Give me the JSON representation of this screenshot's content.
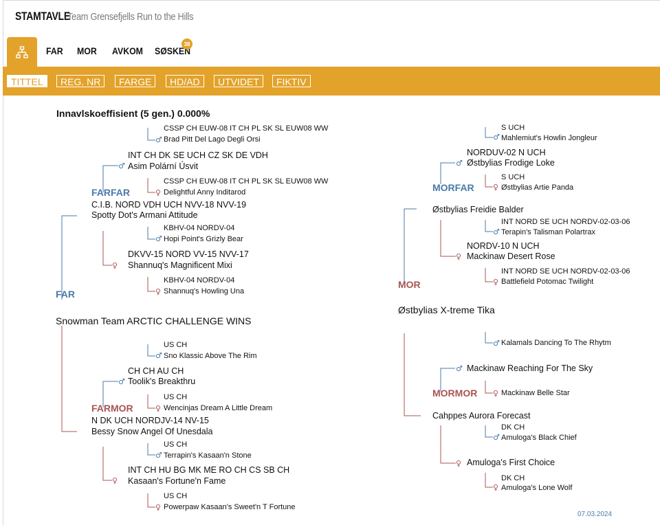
{
  "header": {
    "brand": "STAMTAVLE",
    "subtitle": "Team Grensefjells Run to the Hills"
  },
  "tabs": [
    {
      "label": "FAR"
    },
    {
      "label": "MOR"
    },
    {
      "label": "AVKOM"
    },
    {
      "label": "SØSKEN",
      "badge": "38"
    }
  ],
  "filters": [
    "TITTEL",
    "REG. NR",
    "FARGE",
    "HD/AD",
    "UTVIDET",
    "FIKTIV"
  ],
  "inbreeding": "Innavlskoeffisient (5 gen.) 0.000%",
  "roles": {
    "far": "FAR",
    "mor": "MOR",
    "farfar": "FARFAR",
    "farmor": "FARMOR",
    "morfar": "MORFAR",
    "mormor": "MORMOR"
  },
  "sire": {
    "name": "Snowman Team ARCTIC CHALLENGE WINS"
  },
  "dam": {
    "name": "Østbylias X-treme Tika"
  },
  "paternal": {
    "farfar": {
      "title": "C.I.B. NORD VDH UCH NVV-18 NVV-19",
      "name": "Spotty Dot's Armani Attitude"
    },
    "g3a": {
      "title": "INT CH DK SE UCH CZ SK DE VDH",
      "name": "Asim Polární Úsvit"
    },
    "g4a": {
      "title": "CSSP CH EUW-08 IT CH PL SK SL EUW08 WW",
      "name": "Brad Pitt Del Lago Degli Orsi"
    },
    "g4b": {
      "title": "CSSP CH EUW-08 IT CH PL SK SL EUW08 WW",
      "name": "Delightful Anny Inditarod"
    },
    "g3b": {
      "title": "DKVV-15 NORD VV-15 NVV-17",
      "name": "Shannuq's Magnificent Mixi"
    },
    "g4c": {
      "title": "KBHV-04 NORDV-04",
      "name": "Hopi Point's Grizly Bear"
    },
    "g4d": {
      "title": "KBHV-04 NORDV-04",
      "name": "Shannuq's Howling Una"
    },
    "farmor": {
      "title": "N DK UCH NORDJV-14 NV-15",
      "name": "Bessy Snow Angel Of Unesdala"
    },
    "g3c": {
      "title": "CH CH AU CH",
      "name": "Toolik's Breakthru"
    },
    "g4e": {
      "title": "US CH",
      "name": "Sno Klassic Above The Rim"
    },
    "g4f": {
      "title": "US CH",
      "name": "Wencinjas Dream A Little Dream"
    },
    "g3d": {
      "title": "INT CH HU BG MK ME RO CH CS SB CH",
      "name": "Kasaan's Fortune'n Fame"
    },
    "g4g": {
      "title": "US CH",
      "name": "Terrapin's Kasaan'n Stone"
    },
    "g4h": {
      "title": "US CH",
      "name": "Powerpaw Kasaan's Sweet'n T Fortune"
    }
  },
  "maternal": {
    "morfar": {
      "name": "Østbylias Freidie Balder"
    },
    "g3a": {
      "title": "NORDUV-02 N UCH",
      "name": "Østbylias Frodige Loke"
    },
    "g4a": {
      "title": "S UCH",
      "name": "Mahlemiut's Howlin Jongleur"
    },
    "g4b": {
      "title": "S UCH",
      "name": "Østbylias Artie Panda"
    },
    "g3b": {
      "title": "NORDV-10 N UCH",
      "name": "Mackinaw Desert Rose"
    },
    "g4c": {
      "title": "INT NORD SE UCH NORDV-02-03-06",
      "name": "Terapin's Talisman Polartrax"
    },
    "g4d": {
      "title": "INT NORD SE UCH NORDV-02-03-06",
      "name": "Battlefield Potomac Twilight"
    },
    "mormor": {
      "name": "Cahppes Aurora Forecast"
    },
    "g3c": {
      "name": "Mackinaw Reaching For The Sky"
    },
    "g4e": {
      "name": "Kalamals Dancing To The Rhytm"
    },
    "g4f": {
      "name": "Mackinaw Belle Star"
    },
    "g3d": {
      "name": "Amuloga's First Choice"
    },
    "g4g": {
      "title": "DK CH",
      "name": "Amuloga's Black Chief"
    },
    "g4h": {
      "title": "DK CH",
      "name": "Amuloga's Lone Wolf"
    }
  },
  "footer": {
    "date": "07.03.2024"
  },
  "colors": {
    "accent": "#e3a22a",
    "male": "#4a7aa8",
    "female": "#a85552"
  }
}
